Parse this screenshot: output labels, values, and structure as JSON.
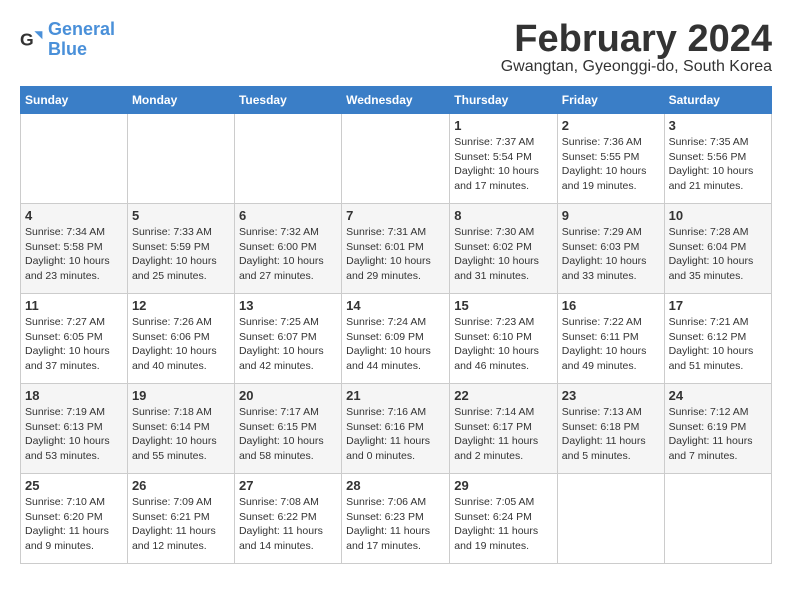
{
  "header": {
    "logo_line1": "General",
    "logo_line2": "Blue",
    "month_year": "February 2024",
    "location": "Gwangtan, Gyeonggi-do, South Korea"
  },
  "weekdays": [
    "Sunday",
    "Monday",
    "Tuesday",
    "Wednesday",
    "Thursday",
    "Friday",
    "Saturday"
  ],
  "weeks": [
    [
      {
        "day": "",
        "info": ""
      },
      {
        "day": "",
        "info": ""
      },
      {
        "day": "",
        "info": ""
      },
      {
        "day": "",
        "info": ""
      },
      {
        "day": "1",
        "info": "Sunrise: 7:37 AM\nSunset: 5:54 PM\nDaylight: 10 hours\nand 17 minutes."
      },
      {
        "day": "2",
        "info": "Sunrise: 7:36 AM\nSunset: 5:55 PM\nDaylight: 10 hours\nand 19 minutes."
      },
      {
        "day": "3",
        "info": "Sunrise: 7:35 AM\nSunset: 5:56 PM\nDaylight: 10 hours\nand 21 minutes."
      }
    ],
    [
      {
        "day": "4",
        "info": "Sunrise: 7:34 AM\nSunset: 5:58 PM\nDaylight: 10 hours\nand 23 minutes."
      },
      {
        "day": "5",
        "info": "Sunrise: 7:33 AM\nSunset: 5:59 PM\nDaylight: 10 hours\nand 25 minutes."
      },
      {
        "day": "6",
        "info": "Sunrise: 7:32 AM\nSunset: 6:00 PM\nDaylight: 10 hours\nand 27 minutes."
      },
      {
        "day": "7",
        "info": "Sunrise: 7:31 AM\nSunset: 6:01 PM\nDaylight: 10 hours\nand 29 minutes."
      },
      {
        "day": "8",
        "info": "Sunrise: 7:30 AM\nSunset: 6:02 PM\nDaylight: 10 hours\nand 31 minutes."
      },
      {
        "day": "9",
        "info": "Sunrise: 7:29 AM\nSunset: 6:03 PM\nDaylight: 10 hours\nand 33 minutes."
      },
      {
        "day": "10",
        "info": "Sunrise: 7:28 AM\nSunset: 6:04 PM\nDaylight: 10 hours\nand 35 minutes."
      }
    ],
    [
      {
        "day": "11",
        "info": "Sunrise: 7:27 AM\nSunset: 6:05 PM\nDaylight: 10 hours\nand 37 minutes."
      },
      {
        "day": "12",
        "info": "Sunrise: 7:26 AM\nSunset: 6:06 PM\nDaylight: 10 hours\nand 40 minutes."
      },
      {
        "day": "13",
        "info": "Sunrise: 7:25 AM\nSunset: 6:07 PM\nDaylight: 10 hours\nand 42 minutes."
      },
      {
        "day": "14",
        "info": "Sunrise: 7:24 AM\nSunset: 6:09 PM\nDaylight: 10 hours\nand 44 minutes."
      },
      {
        "day": "15",
        "info": "Sunrise: 7:23 AM\nSunset: 6:10 PM\nDaylight: 10 hours\nand 46 minutes."
      },
      {
        "day": "16",
        "info": "Sunrise: 7:22 AM\nSunset: 6:11 PM\nDaylight: 10 hours\nand 49 minutes."
      },
      {
        "day": "17",
        "info": "Sunrise: 7:21 AM\nSunset: 6:12 PM\nDaylight: 10 hours\nand 51 minutes."
      }
    ],
    [
      {
        "day": "18",
        "info": "Sunrise: 7:19 AM\nSunset: 6:13 PM\nDaylight: 10 hours\nand 53 minutes."
      },
      {
        "day": "19",
        "info": "Sunrise: 7:18 AM\nSunset: 6:14 PM\nDaylight: 10 hours\nand 55 minutes."
      },
      {
        "day": "20",
        "info": "Sunrise: 7:17 AM\nSunset: 6:15 PM\nDaylight: 10 hours\nand 58 minutes."
      },
      {
        "day": "21",
        "info": "Sunrise: 7:16 AM\nSunset: 6:16 PM\nDaylight: 11 hours\nand 0 minutes."
      },
      {
        "day": "22",
        "info": "Sunrise: 7:14 AM\nSunset: 6:17 PM\nDaylight: 11 hours\nand 2 minutes."
      },
      {
        "day": "23",
        "info": "Sunrise: 7:13 AM\nSunset: 6:18 PM\nDaylight: 11 hours\nand 5 minutes."
      },
      {
        "day": "24",
        "info": "Sunrise: 7:12 AM\nSunset: 6:19 PM\nDaylight: 11 hours\nand 7 minutes."
      }
    ],
    [
      {
        "day": "25",
        "info": "Sunrise: 7:10 AM\nSunset: 6:20 PM\nDaylight: 11 hours\nand 9 minutes."
      },
      {
        "day": "26",
        "info": "Sunrise: 7:09 AM\nSunset: 6:21 PM\nDaylight: 11 hours\nand 12 minutes."
      },
      {
        "day": "27",
        "info": "Sunrise: 7:08 AM\nSunset: 6:22 PM\nDaylight: 11 hours\nand 14 minutes."
      },
      {
        "day": "28",
        "info": "Sunrise: 7:06 AM\nSunset: 6:23 PM\nDaylight: 11 hours\nand 17 minutes."
      },
      {
        "day": "29",
        "info": "Sunrise: 7:05 AM\nSunset: 6:24 PM\nDaylight: 11 hours\nand 19 minutes."
      },
      {
        "day": "",
        "info": ""
      },
      {
        "day": "",
        "info": ""
      }
    ]
  ]
}
